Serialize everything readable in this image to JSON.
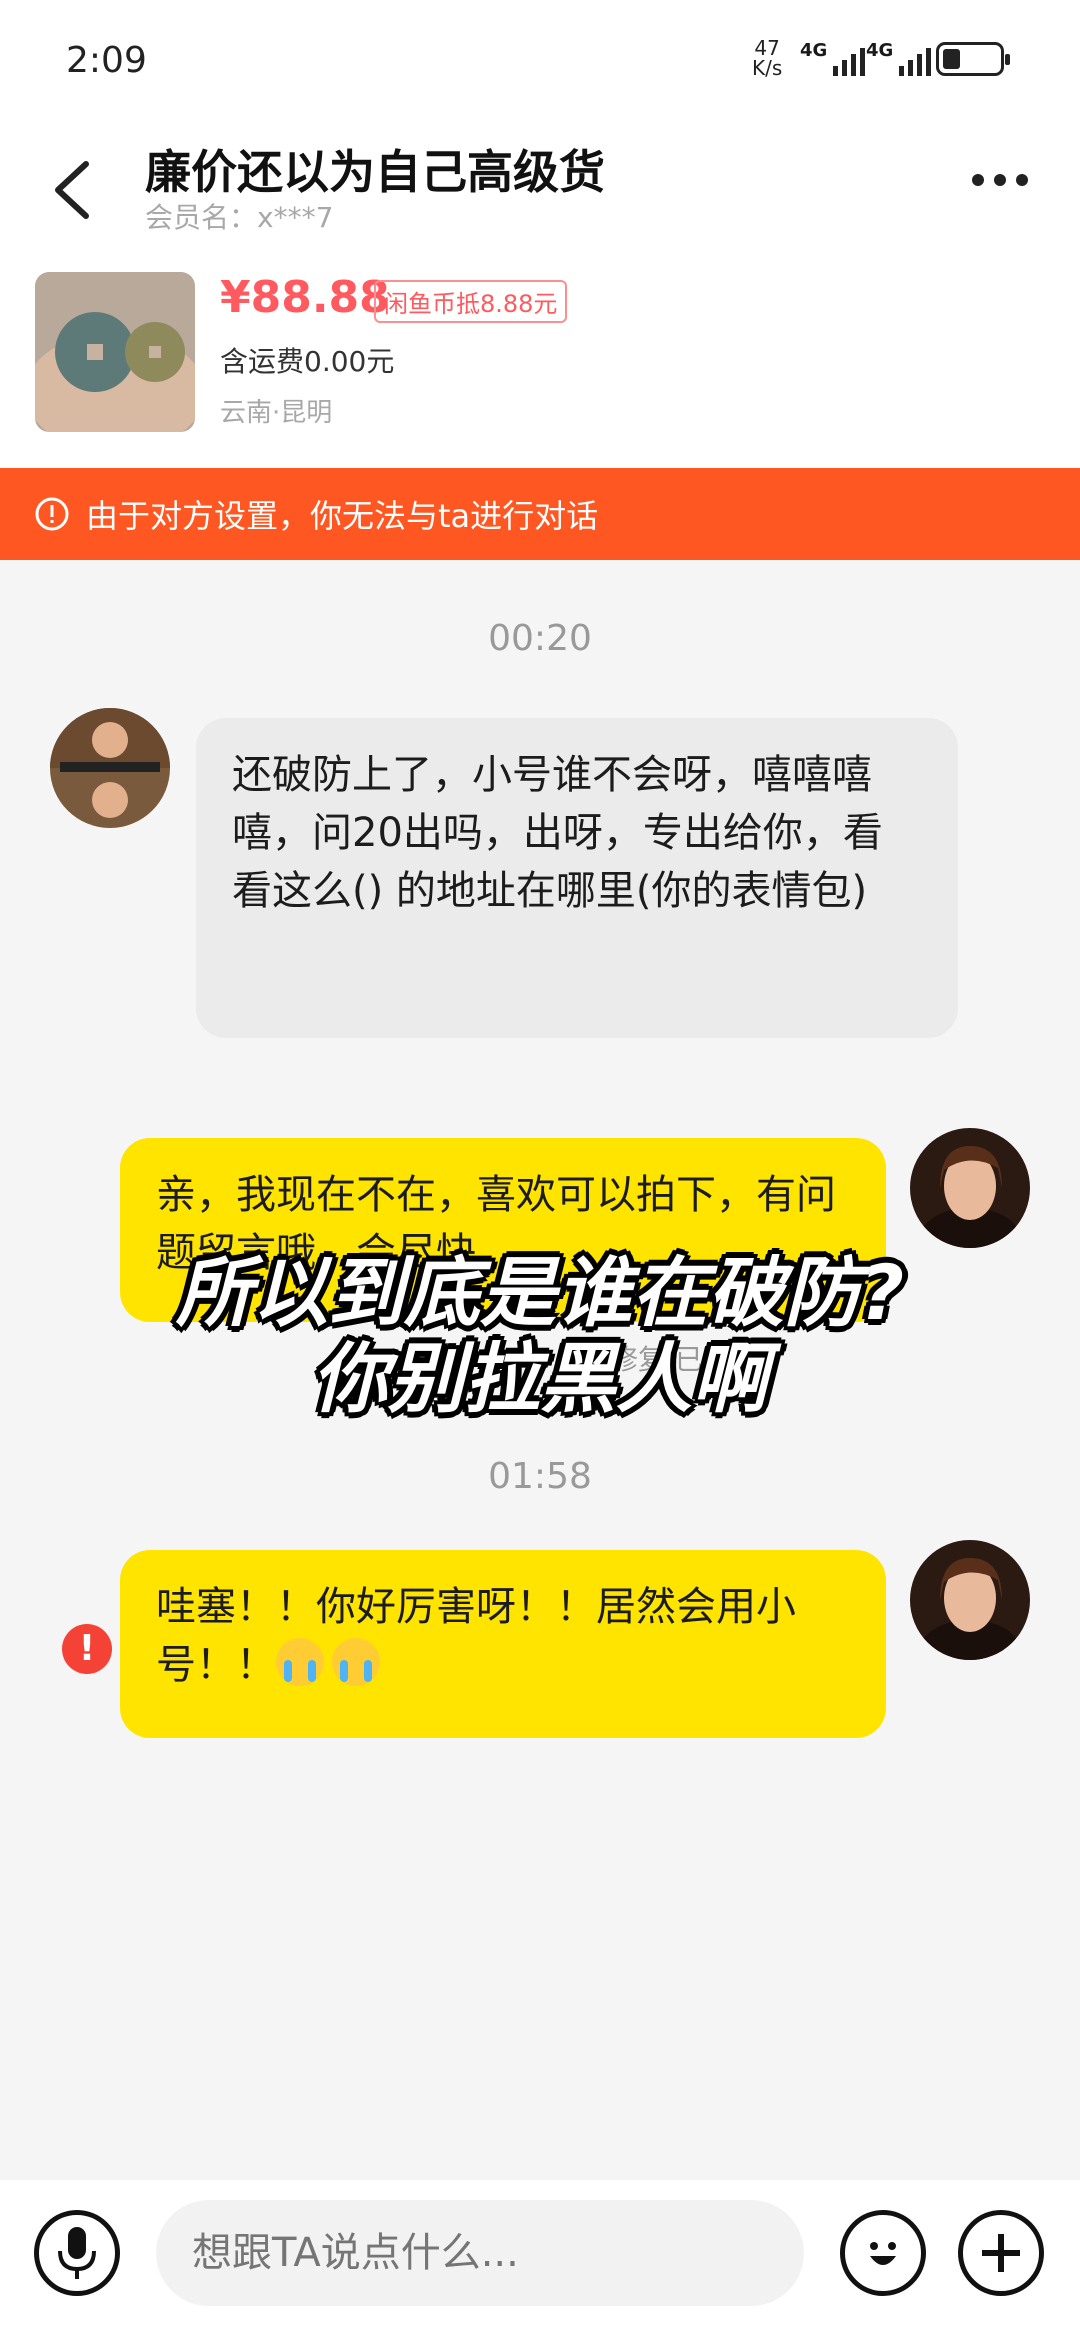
{
  "status_bar": {
    "time": "2:09",
    "net_speed_value": "47",
    "net_speed_unit": "K/s",
    "signal1_label": "4G",
    "signal2_label": "4G"
  },
  "header": {
    "title": "廉价还以为自己高级货",
    "member_label": "会员名：x***7"
  },
  "product": {
    "price": "¥88.88",
    "coin_badge": "闲鱼币抵8.88元",
    "shipping": "含运费0.00元",
    "location": "云南·昆明"
  },
  "banner": {
    "text": "由于对方设置，你无法与ta进行对话",
    "color": "#ff5722"
  },
  "chat": {
    "timestamp1": "00:20",
    "msg_incoming": "还破防上了，小号谁不会呀，嘻嘻嘻嘻，问20出吗，出呀，专出给你，看看这么() 的地址在哪里(你的表情包)",
    "msg_outgoing1": "亲，我现在不在，喜欢可以拍下，有问题留言哦，会尽快",
    "read_status1": "修复·已读",
    "timestamp2": "01:58",
    "msg_outgoing2": "哇塞！！你好厉害呀！！居然会用小号！！",
    "error_icon": "!"
  },
  "overlay_caption": {
    "line1": "所以到底是谁在破防?",
    "line2": "你别拉黑人啊"
  },
  "input_bar": {
    "placeholder": "想跟TA说点什么..."
  },
  "colors": {
    "price": "#ff5a5f",
    "outgoing_bubble": "#ffe400",
    "incoming_bubble": "#ebebeb"
  }
}
